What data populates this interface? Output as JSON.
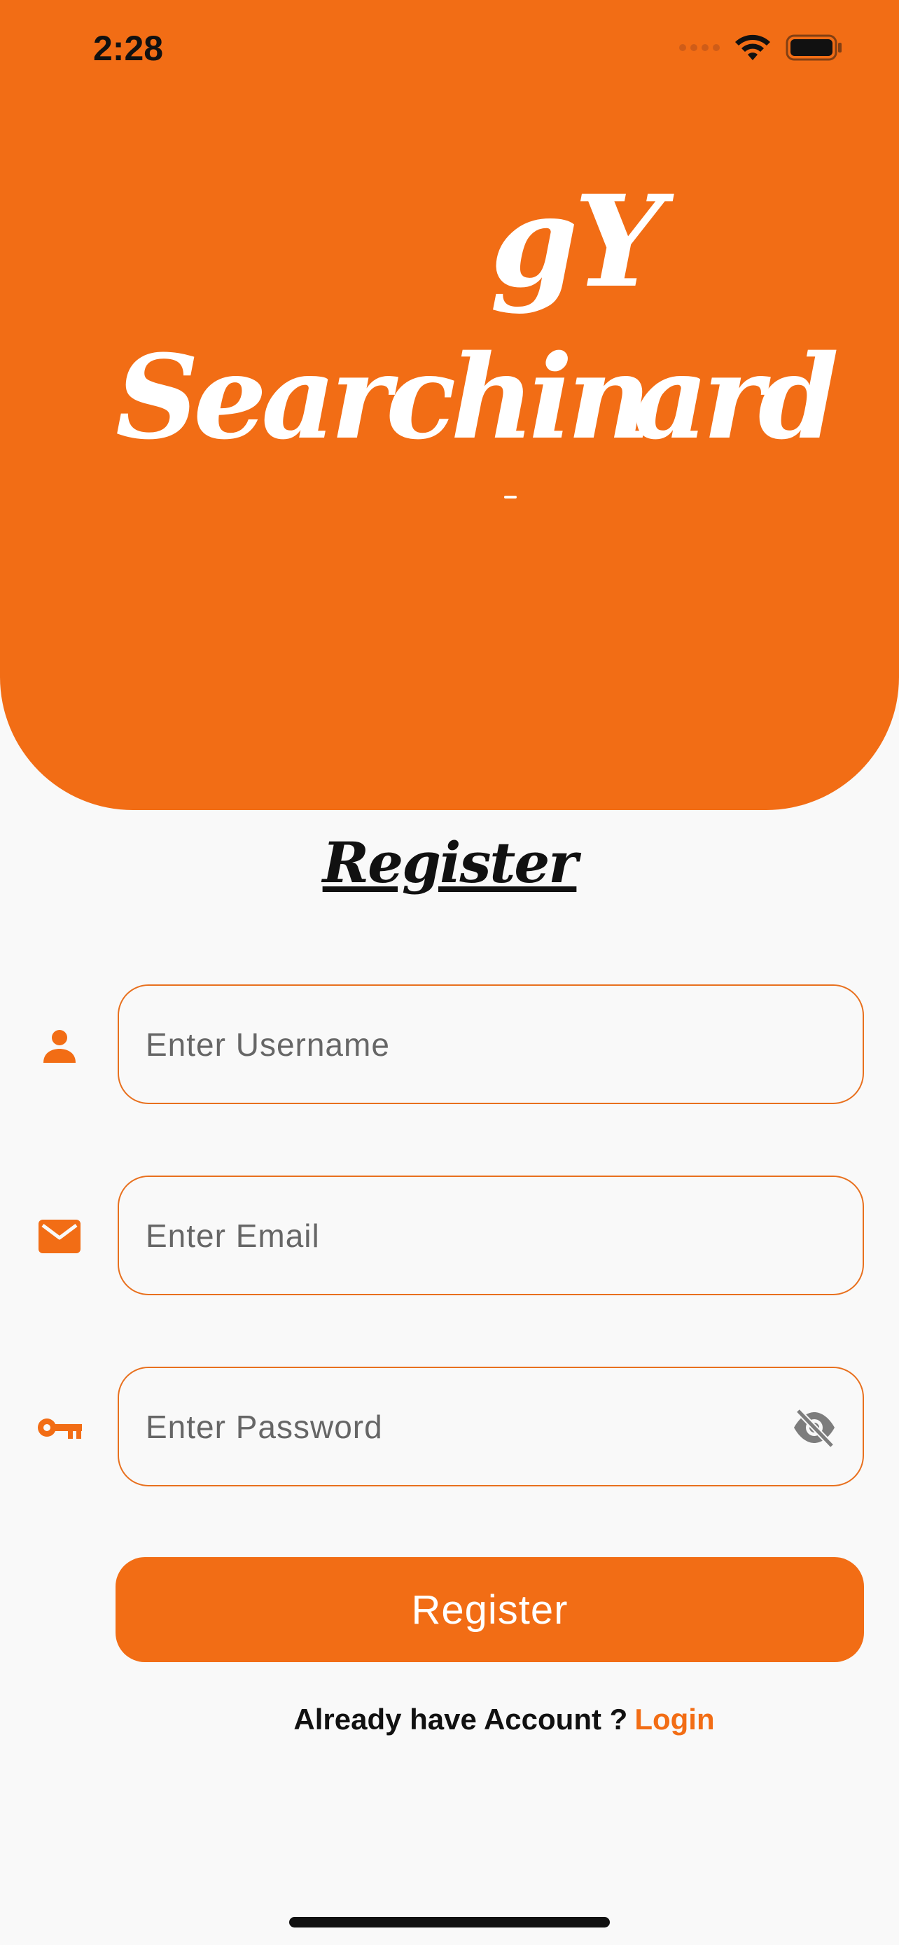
{
  "status_bar": {
    "time": "2:28"
  },
  "app_title": {
    "line1": "gY",
    "line2_left": "Searchin",
    "line2_right": "ard"
  },
  "page": {
    "title": "Register"
  },
  "form": {
    "username": {
      "placeholder": "Enter Username",
      "value": ""
    },
    "email": {
      "placeholder": "Enter Email",
      "value": ""
    },
    "password": {
      "placeholder": "Enter Password",
      "value": ""
    },
    "submit_label": "Register"
  },
  "footer": {
    "prompt": "Already have Account ?",
    "link": "Login"
  },
  "colors": {
    "accent": "#f26d15",
    "background": "#f9f9f9",
    "text": "#111111"
  },
  "icons": {
    "username": "person-icon",
    "email": "mail-icon",
    "password": "key-icon",
    "visibility": "eye-off-icon",
    "wifi": "wifi-icon",
    "battery": "battery-icon"
  }
}
